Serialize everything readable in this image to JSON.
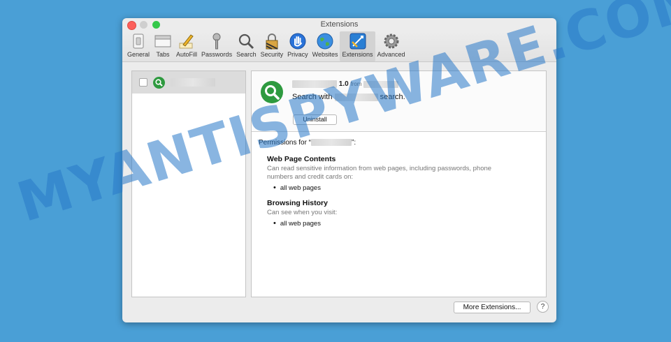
{
  "window": {
    "title": "Extensions"
  },
  "toolbar": {
    "items": [
      {
        "label": "General",
        "icon": "switch-icon"
      },
      {
        "label": "Tabs",
        "icon": "tabs-icon"
      },
      {
        "label": "AutoFill",
        "icon": "pencil-icon"
      },
      {
        "label": "Passwords",
        "icon": "key-icon"
      },
      {
        "label": "Search",
        "icon": "magnifier-icon"
      },
      {
        "label": "Security",
        "icon": "lock-icon"
      },
      {
        "label": "Privacy",
        "icon": "hand-icon"
      },
      {
        "label": "Websites",
        "icon": "globe-icon"
      },
      {
        "label": "Extensions",
        "icon": "extensions-icon"
      },
      {
        "label": "Advanced",
        "icon": "gear-icon"
      }
    ],
    "active": "Extensions"
  },
  "detail": {
    "version": "1.0",
    "from_label": "from",
    "search_prefix": "Search with",
    "search_suffix": "search.",
    "uninstall_label": "Uninstall",
    "permissions_prefix": "Permissions for “",
    "permissions_suffix": "”:",
    "sections": [
      {
        "heading": "Web Page Contents",
        "desc": "Can read sensitive information from web pages, including passwords, phone numbers and credit cards on:",
        "item": "all web pages"
      },
      {
        "heading": "Browsing History",
        "desc": "Can see when you visit:",
        "item": "all web pages"
      }
    ]
  },
  "footer": {
    "more_label": "More Extensions...",
    "help_label": "?"
  },
  "watermark": "MYANTISPYWARE.COM",
  "colors": {
    "accent": "#1f96e8",
    "ext_green": "#2e9a3f",
    "background": "#4a9fd6"
  }
}
